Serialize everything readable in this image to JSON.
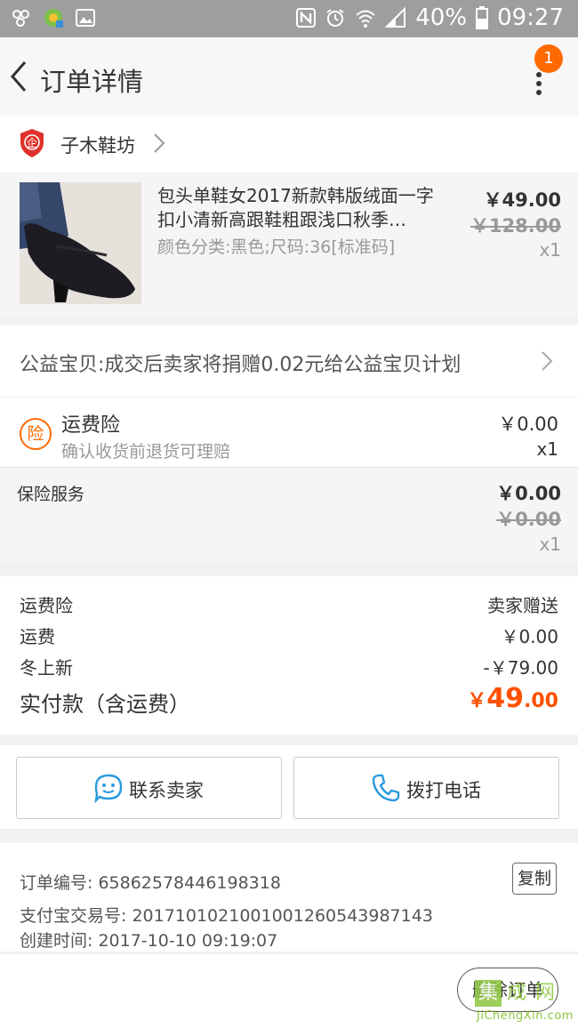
{
  "status_bar": {
    "battery": "40%",
    "time": "09:27"
  },
  "header": {
    "title": "订单详情",
    "badge": "1"
  },
  "shop": {
    "name": "子木鞋坊",
    "badge_char": "企"
  },
  "product": {
    "title": "包头单鞋女2017新款韩版绒面一字扣小清新高跟鞋粗跟浅口秋季…",
    "sku": "颜色分类:黑色;尺码:36[标准码]",
    "price": "￥49.00",
    "original_price": "￥128.00",
    "quantity": "x1"
  },
  "charity": {
    "text": "公益宝贝:成交后卖家将捐赠0.02元给公益宝贝计划"
  },
  "freight_insurance": {
    "icon_char": "险",
    "title": "运费险",
    "subtitle": "确认收货前退货可理赔",
    "price": "￥0.00",
    "quantity": "x1"
  },
  "insurance_service": {
    "title": "保险服务",
    "price": "￥0.00",
    "original_price": "￥0.00",
    "quantity": "x1"
  },
  "summary": {
    "rows": [
      {
        "label": "运费险",
        "value": "卖家赠送"
      },
      {
        "label": "运费",
        "value": "￥0.00"
      },
      {
        "label": "冬上新",
        "value": "-￥79.00"
      }
    ],
    "paid_label": "实付款（含运费）",
    "paid_currency": "￥",
    "paid_integer": "49",
    "paid_decimal": ".00"
  },
  "actions": {
    "contact_seller": "联系卖家",
    "call_phone": "拨打电话"
  },
  "order_info": {
    "order_no": "订单编号: 65862578446198318",
    "alipay_no": "支付宝交易号: 2017101021001001260543987143",
    "created": "创建时间: 2017-10-10 09:19:07",
    "copy_label": "复制"
  },
  "bottom": {
    "delete_label": "删除订单"
  },
  "watermark": {
    "chars": [
      "集",
      "成",
      "网"
    ],
    "url": "JiChengXin.com"
  },
  "colors": {
    "accent": "#ff5000",
    "badge": "#ff6a00",
    "blue_icon": "#2a9ae0"
  }
}
